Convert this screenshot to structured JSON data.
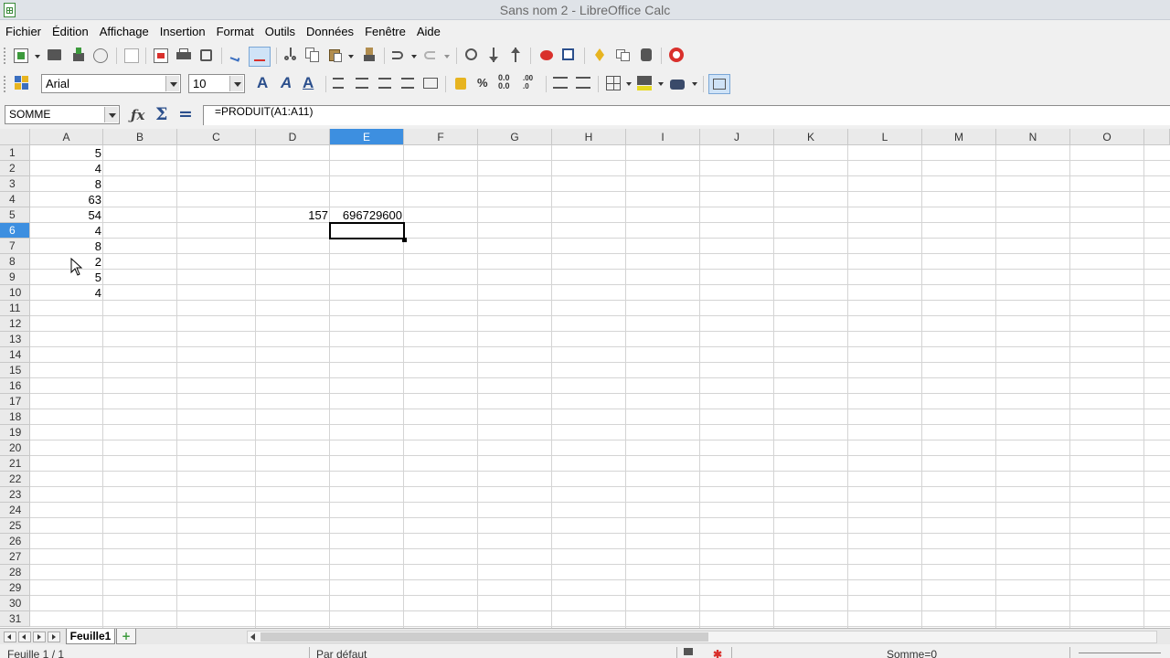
{
  "window": {
    "title": "Sans nom 2 - LibreOffice Calc"
  },
  "menu": [
    "Fichier",
    "Édition",
    "Affichage",
    "Insertion",
    "Format",
    "Outils",
    "Données",
    "Fenêtre",
    "Aide"
  ],
  "format_toolbar": {
    "font_name": "Arial",
    "font_size": "10"
  },
  "formula_bar": {
    "name_box": "SOMME",
    "formula": "=PRODUIT(A1:A11)"
  },
  "columns": [
    "A",
    "B",
    "C",
    "D",
    "E",
    "F",
    "G",
    "H",
    "I",
    "J",
    "K",
    "L",
    "M",
    "N",
    "O"
  ],
  "active_column": "E",
  "active_row": 6,
  "rows": [
    "1",
    "2",
    "3",
    "4",
    "5",
    "6",
    "7",
    "8",
    "9",
    "10",
    "11",
    "12",
    "13",
    "14",
    "15",
    "16",
    "17",
    "18",
    "19",
    "20",
    "21",
    "22",
    "23",
    "24",
    "25",
    "26",
    "27",
    "28",
    "29",
    "30",
    "31"
  ],
  "cells": {
    "A1": "5",
    "A2": "4",
    "A3": "8",
    "A4": "63",
    "A5": "54",
    "A6": "4",
    "A7": "8",
    "A8": "2",
    "A9": "5",
    "A10": "4",
    "D5": "157",
    "E5": "696729600"
  },
  "sheet_tabs": {
    "active": "Feuille1"
  },
  "status_bar": {
    "sheet": "Feuille 1 / 1",
    "style": "Par défaut",
    "sum": "Somme=0"
  },
  "colors": {
    "selection_header": "#3d8fe0",
    "grid_line": "#d4d4d4"
  }
}
